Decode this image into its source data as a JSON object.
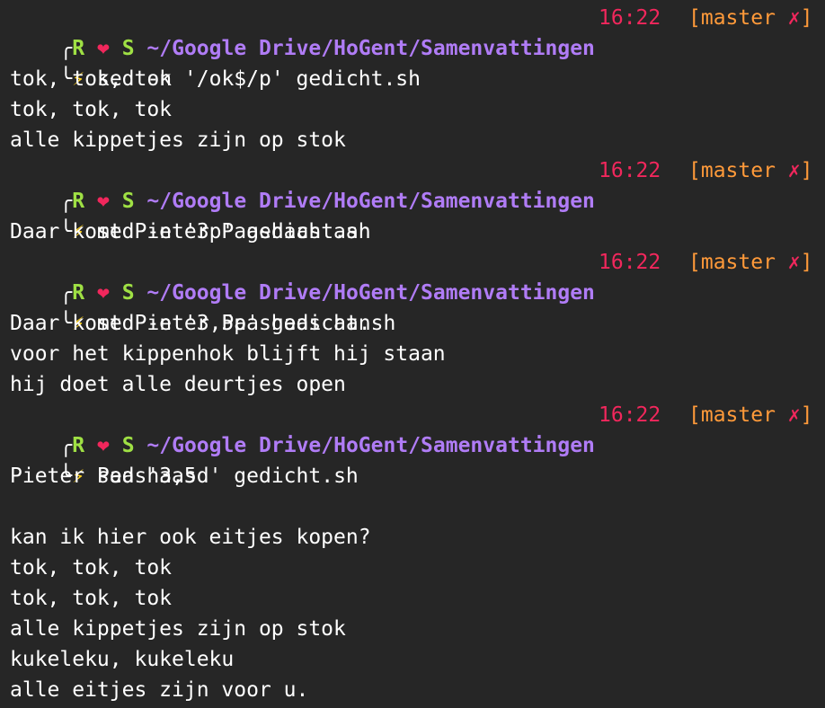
{
  "prompt": {
    "corner_top": "╭",
    "corner_bottom": "╰",
    "user_left": "R",
    "heart": "❤",
    "user_right": "S",
    "path": "~/Google Drive/HoGent/Samenvattingen",
    "time": "16:22",
    "git_open": "[master ",
    "git_dirty": "✗",
    "git_close": "]",
    "bolt": "⚡"
  },
  "blocks": [
    {
      "command": "sed -n '/ok$/p' gedicht.sh",
      "output": [
        "tok, tok, tok",
        "tok, tok, tok",
        "alle kippetjes zijn op stok"
      ]
    },
    {
      "command": "sed -n '3p' gedicht.sh",
      "output": [
        "Daar komt Pieter Paashaas aan"
      ]
    },
    {
      "command": "sed -n '3,5p' gedicht.sh",
      "output": [
        "Daar komt Pieter Paashaas aan",
        "voor het kippenhok blijft hij staan",
        "hij doet alle deurtjes open"
      ]
    },
    {
      "command": "sed '3,5d' gedicht.sh",
      "output": [
        "Pieter Paashaas",
        "",
        "kan ik hier ook eitjes kopen?",
        "tok, tok, tok",
        "tok, tok, tok",
        "alle kippetjes zijn op stok",
        "kukeleku, kukeleku",
        "alle eitjes zijn voor u."
      ]
    }
  ],
  "colors": {
    "background": "#262626",
    "user": "#9fe044",
    "heart": "#f1275c",
    "path": "#b07cf6",
    "time": "#f1275c",
    "git": "#ff9a3a",
    "git_dirty": "#f1275c",
    "bolt": "#ffd21f",
    "text": "#ffffff"
  }
}
